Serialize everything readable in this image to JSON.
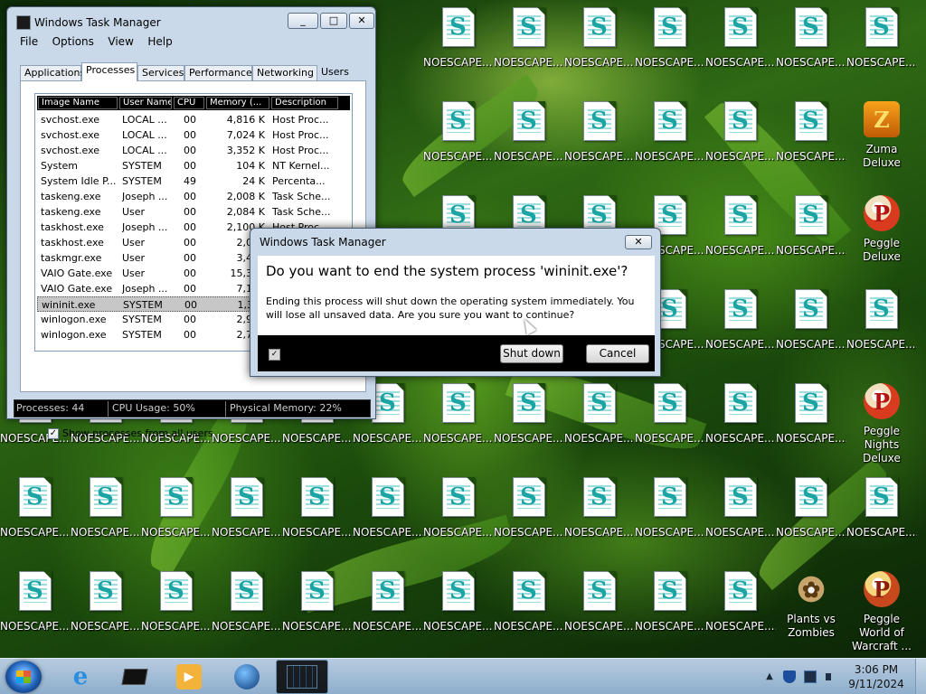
{
  "desktop": {
    "icon_label": "NOESCAPE....",
    "apps": {
      "zuma": "Zuma Deluxe",
      "peggle": "Peggle Deluxe",
      "peggle_nights": "Peggle Nights Deluxe",
      "pvz": "Plants vs Zombies",
      "peggle_wow": "Peggle World of Warcraft ..."
    }
  },
  "task_manager": {
    "title": "Windows Task Manager",
    "window_buttons": {
      "minimize": "_",
      "maximize": "□",
      "close": "✕"
    },
    "menu": [
      "File",
      "Options",
      "View",
      "Help"
    ],
    "tabs": [
      "Applications",
      "Processes",
      "Services",
      "Performance",
      "Networking",
      "Users"
    ],
    "active_tab": "Processes",
    "columns": [
      "Image Name",
      "User Name",
      "CPU",
      "Memory (...",
      "Description"
    ],
    "rows": [
      [
        "svchost.exe",
        "LOCAL ...",
        "00",
        "4,816 K",
        "Host Proc..."
      ],
      [
        "svchost.exe",
        "LOCAL ...",
        "00",
        "7,024 K",
        "Host Proc..."
      ],
      [
        "svchost.exe",
        "LOCAL ...",
        "00",
        "3,352 K",
        "Host Proc..."
      ],
      [
        "System",
        "SYSTEM",
        "00",
        "104 K",
        "NT Kernel..."
      ],
      [
        "System Idle P...",
        "SYSTEM",
        "49",
        "24 K",
        "Percenta..."
      ],
      [
        "taskeng.exe",
        "Joseph ...",
        "00",
        "2,008 K",
        "Task Sche..."
      ],
      [
        "taskeng.exe",
        "User",
        "00",
        "2,084 K",
        "Task Sche..."
      ],
      [
        "taskhost.exe",
        "Joseph ...",
        "00",
        "2,100 K",
        "Host Proc..."
      ],
      [
        "taskhost.exe",
        "User",
        "00",
        "2,084",
        ""
      ],
      [
        "taskmgr.exe",
        "User",
        "00",
        "3,460",
        ""
      ],
      [
        "VAIO Gate.exe",
        "User",
        "00",
        "15,380",
        ""
      ],
      [
        "VAIO Gate.exe",
        "Joseph ...",
        "00",
        "7,180",
        ""
      ],
      [
        "wininit.exe",
        "SYSTEM",
        "00",
        "1,340",
        ""
      ],
      [
        "winlogon.exe",
        "SYSTEM",
        "00",
        "2,988",
        ""
      ],
      [
        "winlogon.exe",
        "SYSTEM",
        "00",
        "2,724",
        ""
      ]
    ],
    "show_all_label": "Show processes from all users",
    "show_all_checked": "✓",
    "status": {
      "processes": "Processes: 44",
      "cpu": "CPU Usage: 50%",
      "memory": "Physical Memory: 22%"
    }
  },
  "dialog": {
    "title": "Windows Task Manager",
    "close": "✕",
    "question": "Do you want to end the system process 'wininit.exe'?",
    "message": "Ending this process will shut down the operating system immediately.  You will lose all unsaved data.  Are you sure you want to continue?",
    "checkbox_mark": "✓",
    "shutdown_label": "Shut down",
    "cancel_label": "Cancel"
  },
  "taskbar": {
    "clock_time": "3:06 PM",
    "clock_date": "9/11/2024",
    "tray_chevron": "▲"
  }
}
